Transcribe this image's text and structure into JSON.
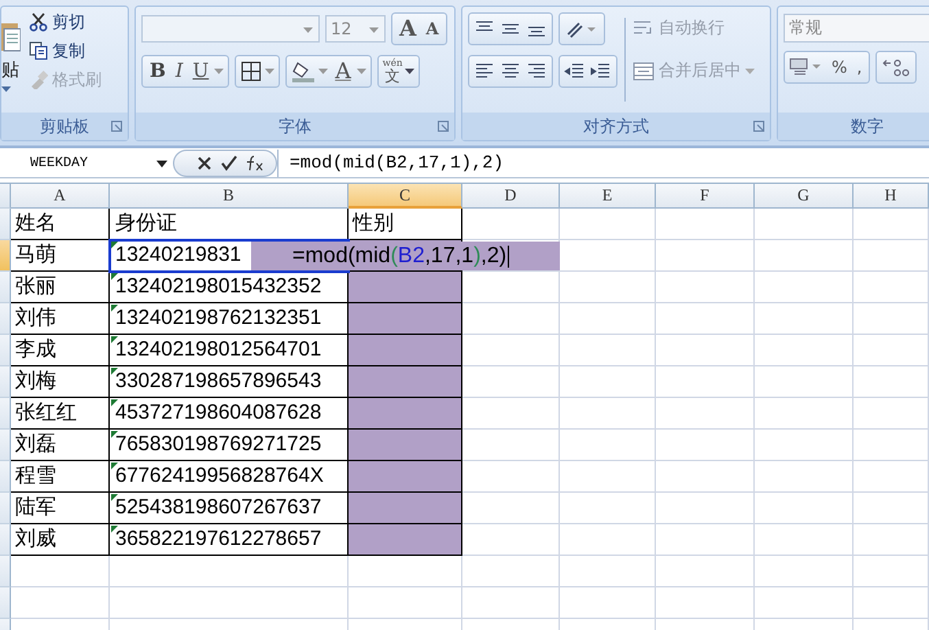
{
  "ribbon": {
    "clipboard": {
      "paste_label": "贴",
      "label": "剪贴板",
      "items": [
        {
          "kind": "cut",
          "label": "剪切",
          "disabled": false
        },
        {
          "kind": "copy",
          "label": "复制",
          "disabled": false
        },
        {
          "kind": "brush",
          "label": "格式刷",
          "disabled": true
        }
      ]
    },
    "font": {
      "label": "字体",
      "size": "12",
      "grow": "A",
      "shrink": "A",
      "styles": [
        "B",
        "I",
        "U"
      ],
      "font_color_letter": "A",
      "phonetic": "wén",
      "phonetic_char": "文"
    },
    "alignment": {
      "label": "对齐方式",
      "wrap": {
        "label": "自动换行",
        "disabled": true
      },
      "merge": {
        "label": "合并后居中",
        "disabled": true
      }
    },
    "number": {
      "label": "数字",
      "format": "常规",
      "percent": "%",
      "comma": ","
    }
  },
  "formula_bar": {
    "name_box": "WEEKDAY",
    "formula": "=mod(mid(B2,17,1),2)"
  },
  "columns": [
    {
      "label": "A",
      "selected": false
    },
    {
      "label": "B",
      "selected": false
    },
    {
      "label": "C",
      "selected": true
    },
    {
      "label": "D",
      "selected": false
    },
    {
      "label": "E",
      "selected": false
    },
    {
      "label": "F",
      "selected": false
    },
    {
      "label": "G",
      "selected": false
    },
    {
      "label": "H",
      "selected": false
    }
  ],
  "rows": [
    {
      "selected": false,
      "name": "姓名",
      "id": "身份证",
      "gender": "性别",
      "number_as_text": false,
      "filled": false
    },
    {
      "selected": true,
      "name": "马萌",
      "id": "13240219831",
      "number_as_text": true,
      "filled": true
    },
    {
      "selected": false,
      "name": "张丽",
      "id": "132402198015432352",
      "number_as_text": true,
      "filled": true
    },
    {
      "selected": false,
      "name": "刘伟",
      "id": "132402198762132351",
      "number_as_text": true,
      "filled": true
    },
    {
      "selected": false,
      "name": "李成",
      "id": "132402198012564701",
      "number_as_text": true,
      "filled": true
    },
    {
      "selected": false,
      "name": "刘梅",
      "id": "330287198657896543",
      "number_as_text": true,
      "filled": true
    },
    {
      "selected": false,
      "name": "张红红",
      "id": "453727198604087628",
      "number_as_text": true,
      "filled": true
    },
    {
      "selected": false,
      "name": "刘磊",
      "id": "765830198769271725",
      "number_as_text": true,
      "filled": true
    },
    {
      "selected": false,
      "name": "程雪",
      "id": "67762419956828764X",
      "number_as_text": true,
      "filled": true
    },
    {
      "selected": false,
      "name": "陆军",
      "id": "525438198607267637",
      "number_as_text": true,
      "filled": true
    },
    {
      "selected": false,
      "name": "刘威",
      "id": "365822197612278657",
      "number_as_text": true,
      "filled": true
    }
  ],
  "cell_editor": {
    "segments": [
      {
        "text": "=mod(mid",
        "color": "#000000"
      },
      {
        "text": "(",
        "color": "#2e8b57"
      },
      {
        "text": "B2",
        "color": "#1f1fd0"
      },
      {
        "text": ",17,1",
        "color": "#000000"
      },
      {
        "text": ")",
        "color": "#2e8b57"
      },
      {
        "text": ",2)",
        "color": "#000000"
      }
    ]
  }
}
